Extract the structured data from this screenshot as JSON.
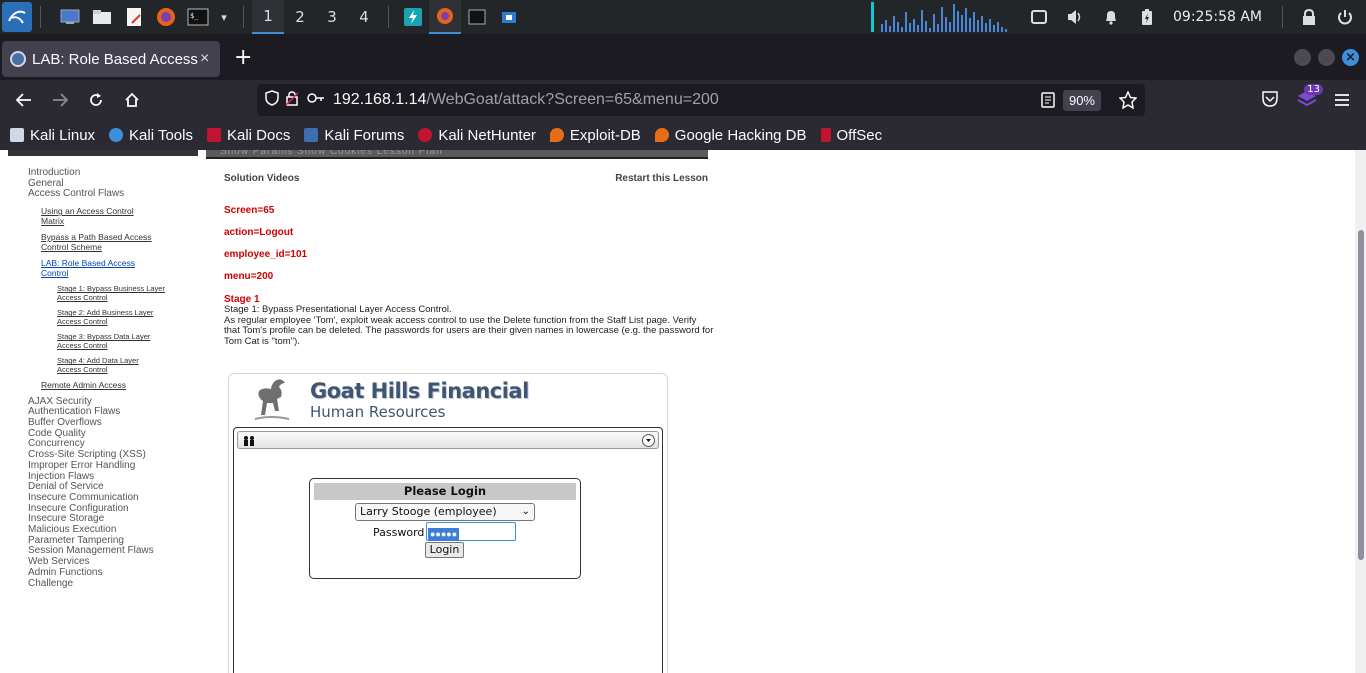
{
  "taskbar": {
    "workspaces": [
      "1",
      "2",
      "3",
      "4"
    ],
    "clock": "09:25:58 AM",
    "accent_color": "#3d8fdc"
  },
  "browser": {
    "tab_title": "LAB: Role Based Access C",
    "tab_close": "×",
    "new_tab": "+",
    "url_host": "192.168.1.14",
    "url_path": "/WebGoat/attack?Screen=65&menu=200",
    "zoom": "90%",
    "extension_badge": "13"
  },
  "bookmarks": [
    {
      "label": "Kali Linux",
      "color": "#cfd8e6"
    },
    {
      "label": "Kali Tools",
      "color": "#3d8fdc"
    },
    {
      "label": "Kali Docs",
      "color": "#c0142f"
    },
    {
      "label": "Kali Forums",
      "color": "#3d6fb0"
    },
    {
      "label": "Kali NetHunter",
      "color": "#c0142f"
    },
    {
      "label": "Exploit-DB",
      "color": "#e86b18"
    },
    {
      "label": "Google Hacking DB",
      "color": "#e86b18"
    },
    {
      "label": "OffSec",
      "color": "#c0142f"
    }
  ],
  "page": {
    "header_fragment": "Show Params   Show Cookies   Lesson Plan",
    "solution_videos": "Solution Videos",
    "restart_lesson": "Restart this Lesson",
    "params": {
      "screen": "Screen=65",
      "action": "action=Logout",
      "employee_id": "employee_id=101",
      "menu": "menu=200"
    },
    "stage_heading": "Stage 1",
    "stage_line1": "Stage 1: Bypass Presentational Layer Access Control.",
    "stage_line2": "As regular employee 'Tom', exploit weak access control to use the Delete function from the Staff List page. Verify that Tom's profile can be deleted. The passwords for users are their given names in lowercase (e.g. the password for Tom Cat is \"tom\")."
  },
  "leftnav": {
    "top": [
      "Introduction",
      "General",
      "Access Control Flaws"
    ],
    "access_control": [
      "Using an Access Control Matrix",
      "Bypass a Path Based Access Control Scheme",
      "LAB: Role Based Access Control"
    ],
    "stages": [
      "Stage 1: Bypass Business Layer Access Control",
      "Stage 2: Add Business Layer Access Control",
      "Stage 3: Bypass Data Layer Access Control",
      "Stage 4: Add Data Layer Access Control"
    ],
    "remote_admin": "Remote Admin Access",
    "categories": [
      "AJAX Security",
      "Authentication Flaws",
      "Buffer Overflows",
      "Code Quality",
      "Concurrency",
      "Cross-Site Scripting (XSS)",
      "Improper Error Handling",
      "Injection Flaws",
      "Denial of Service",
      "Insecure Communication",
      "Insecure Configuration",
      "Insecure Storage",
      "Malicious Execution",
      "Parameter Tampering",
      "Session Management Flaws",
      "Web Services",
      "Admin Functions",
      "Challenge"
    ]
  },
  "app": {
    "title": "Goat Hills Financial",
    "subtitle": "Human Resources",
    "login_heading": "Please Login",
    "selected_user": "Larry Stooge (employee)",
    "password_label": "Password",
    "password_value": "●●●●●",
    "login_button": "Login"
  }
}
